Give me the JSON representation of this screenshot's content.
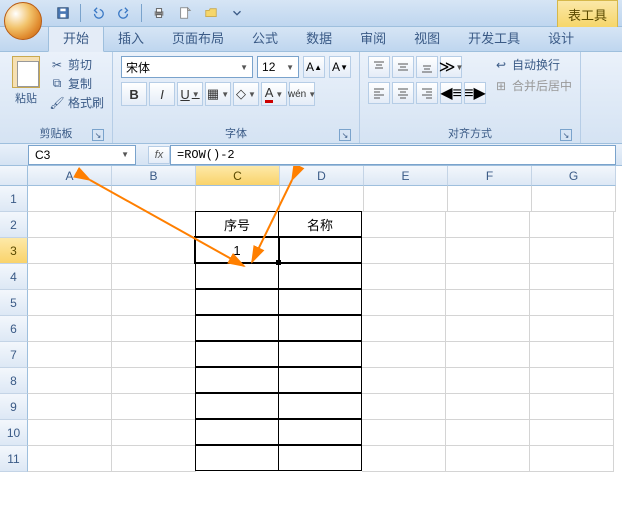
{
  "qat": {
    "tool_tab": "表工具"
  },
  "tabs": {
    "items": [
      "开始",
      "插入",
      "页面布局",
      "公式",
      "数据",
      "审阅",
      "视图",
      "开发工具",
      "设计"
    ],
    "active_index": 0
  },
  "clipboard": {
    "paste": "粘贴",
    "cut": "剪切",
    "copy": "复制",
    "format_painter": "格式刷",
    "group_label": "剪贴板"
  },
  "font": {
    "name": "宋体",
    "size": "12",
    "group_label": "字体",
    "bold": "B",
    "italic": "I",
    "underline": "U"
  },
  "alignment": {
    "group_label": "对齐方式",
    "wrap_text": "自动换行",
    "merge_center": "合并后居中"
  },
  "name_box": "C3",
  "fx_label": "fx",
  "formula": "=ROW()-2",
  "columns": [
    "A",
    "B",
    "C",
    "D",
    "E",
    "F",
    "G"
  ],
  "rows": [
    "1",
    "2",
    "3",
    "4",
    "5",
    "6",
    "7",
    "8",
    "9",
    "10",
    "11"
  ],
  "active_col": "C",
  "active_row": "3",
  "cells": {
    "C2": "序号",
    "D2": "名称",
    "C3": "1"
  },
  "table_range": {
    "col_start": 2,
    "col_end": 3,
    "row_start": 1,
    "row_end": 10
  }
}
